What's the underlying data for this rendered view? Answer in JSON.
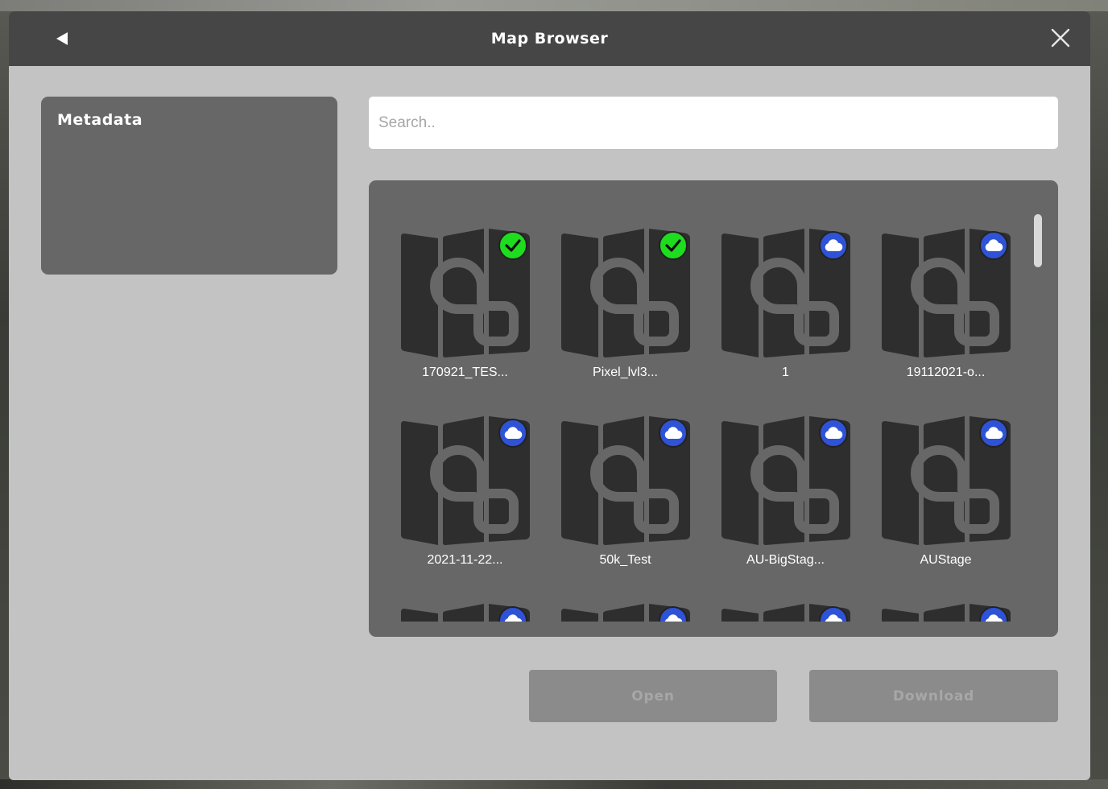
{
  "window": {
    "title": "Map Browser",
    "back_icon": "back-triangle-icon",
    "close_icon": "close-icon"
  },
  "metadata": {
    "title": "Metadata"
  },
  "search": {
    "placeholder": "Search..",
    "value": ""
  },
  "maps": [
    {
      "label": "170921_TES...",
      "status": "downloaded"
    },
    {
      "label": "Pixel_lvl3...",
      "status": "downloaded"
    },
    {
      "label": "1",
      "status": "cloud"
    },
    {
      "label": "19112021-o...",
      "status": "cloud"
    },
    {
      "label": "2021-11-22...",
      "status": "cloud"
    },
    {
      "label": "50k_Test",
      "status": "cloud"
    },
    {
      "label": "AU-BigStag...",
      "status": "cloud"
    },
    {
      "label": "AUStage",
      "status": "cloud"
    },
    {
      "label": "",
      "status": "cloud"
    },
    {
      "label": "",
      "status": "cloud"
    },
    {
      "label": "",
      "status": "cloud"
    },
    {
      "label": "",
      "status": "cloud"
    }
  ],
  "actions": {
    "open_label": "Open",
    "download_label": "Download"
  },
  "colors": {
    "downloaded_badge": "#1edc1e",
    "cloud_badge": "#2f53d6",
    "panel": "#676767",
    "titlebar": "#464646"
  }
}
